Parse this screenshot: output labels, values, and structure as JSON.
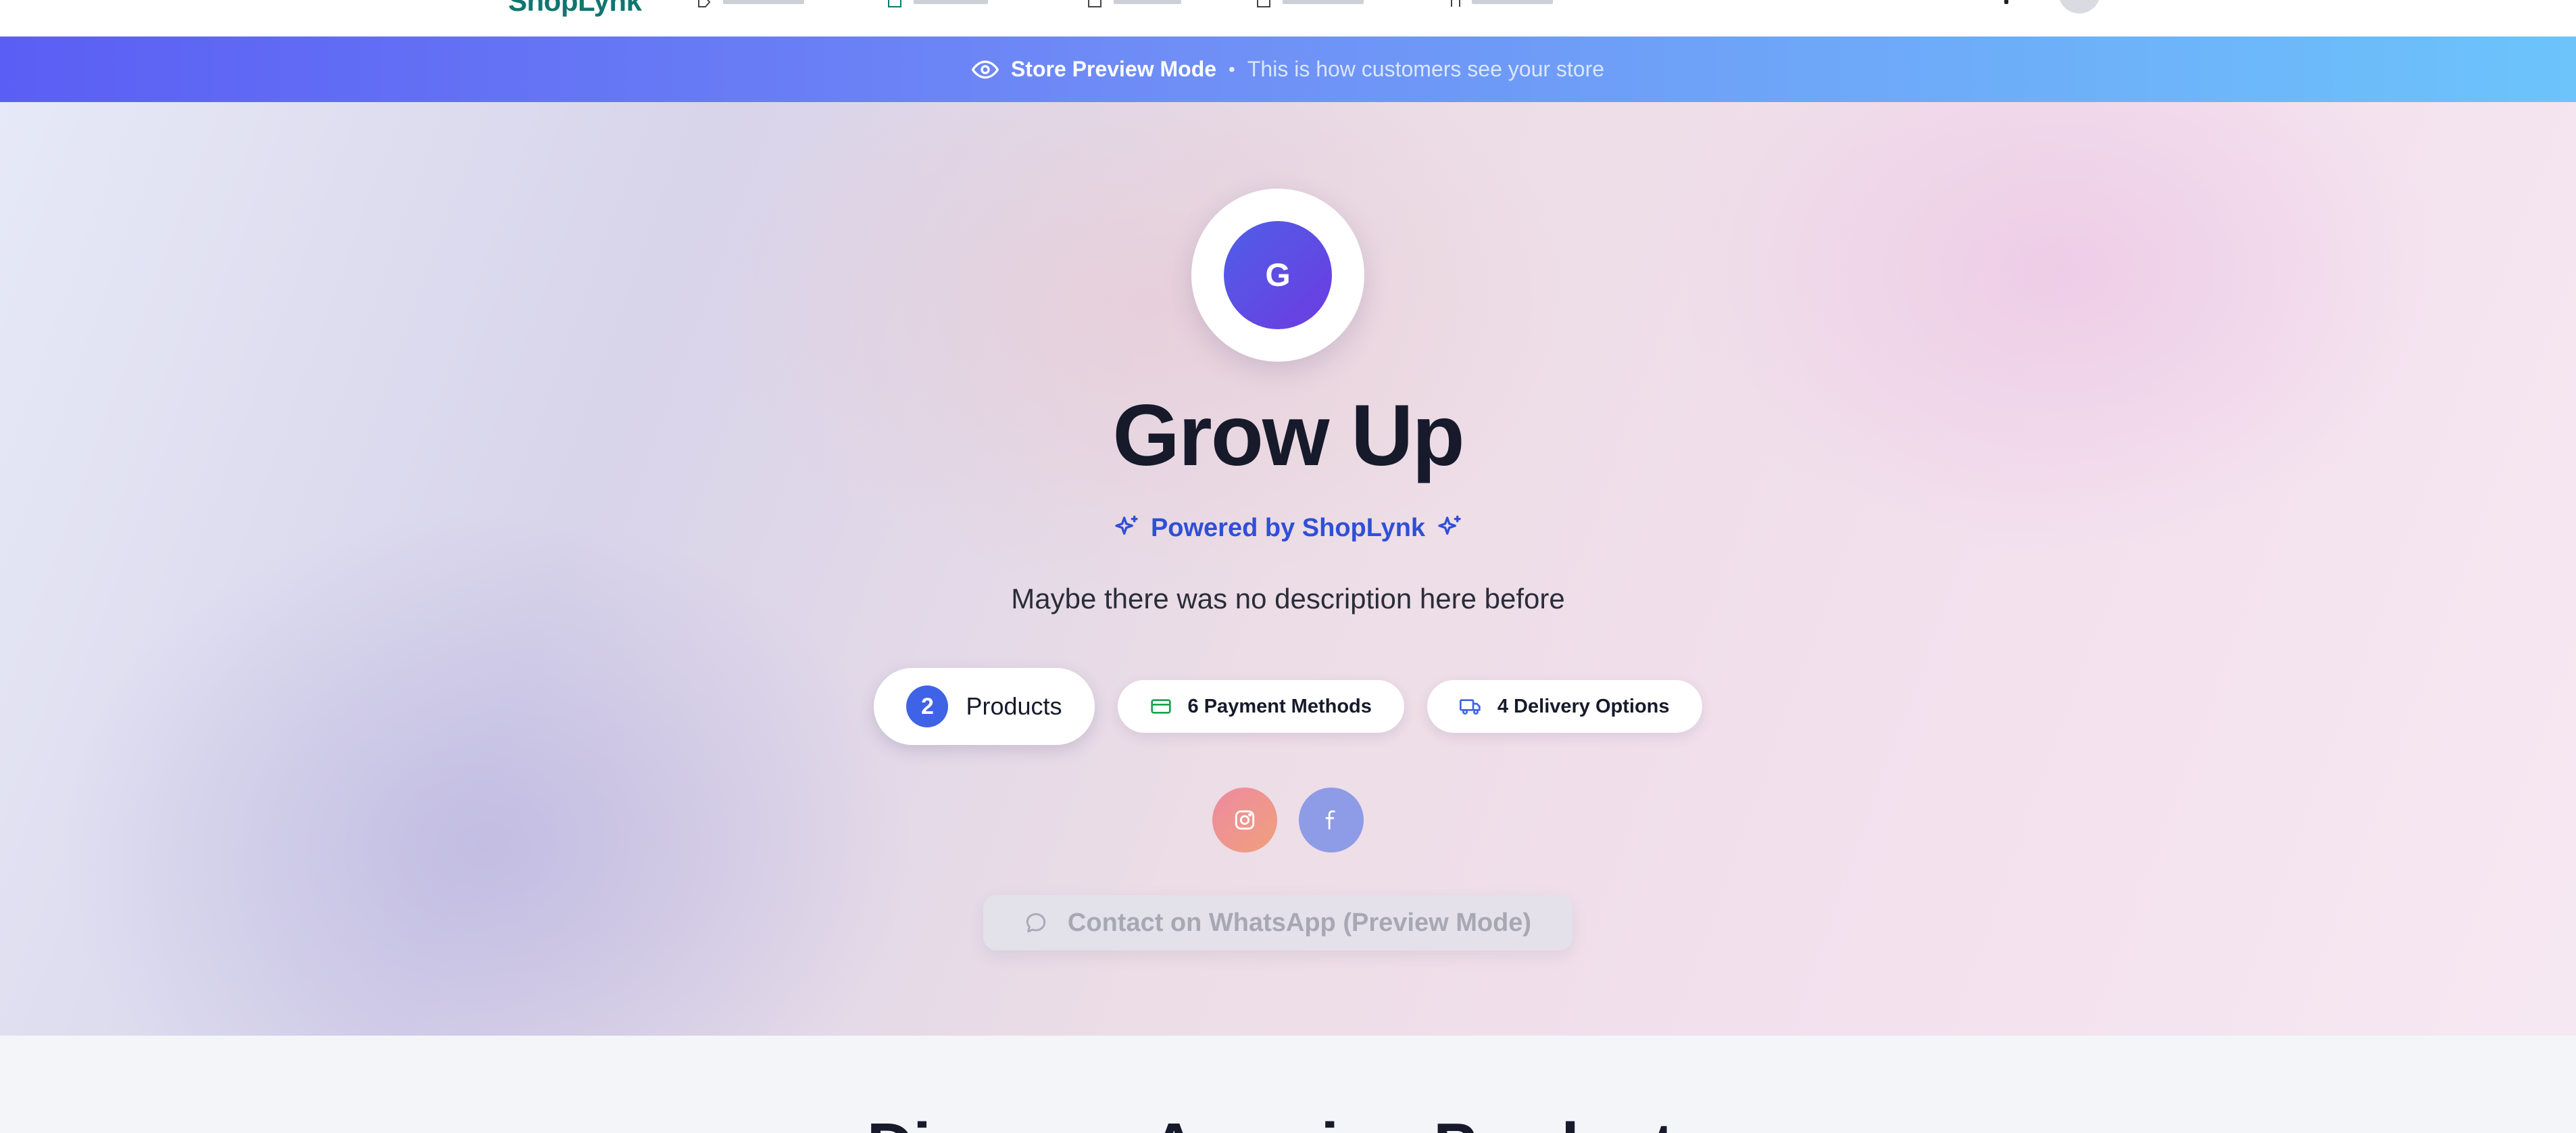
{
  "nav": {
    "brand": "ShopLynk",
    "icons": [
      "tag-icon",
      "store-icon",
      "orders-icon",
      "analytics-icon",
      "settings-icon"
    ]
  },
  "banner": {
    "title": "Store Preview Mode",
    "separator": "•",
    "subtitle": "This is how customers see your store",
    "colors": {
      "start": "#5b5ef4",
      "end": "#6cc4fb"
    }
  },
  "store": {
    "initial": "G",
    "name": "Grow Up",
    "powered_by": "Powered by ShopLynk",
    "description": "Maybe there was no description here before"
  },
  "stats": {
    "products_count": "2",
    "products_label": "Products",
    "payment_label": "6 Payment Methods",
    "delivery_label": "4 Delivery Options"
  },
  "socials": [
    {
      "name": "instagram-icon"
    },
    {
      "name": "facebook-icon"
    }
  ],
  "contact": {
    "label": "Contact on WhatsApp (Preview Mode)"
  },
  "section": {
    "title": "Discover Amazing Products"
  },
  "colors": {
    "accent": "#3f63e6",
    "powered": "#2f4fd6",
    "title": "#161a2b",
    "payment_icon": "#16a34a",
    "delivery_icon": "#3f63e6"
  }
}
